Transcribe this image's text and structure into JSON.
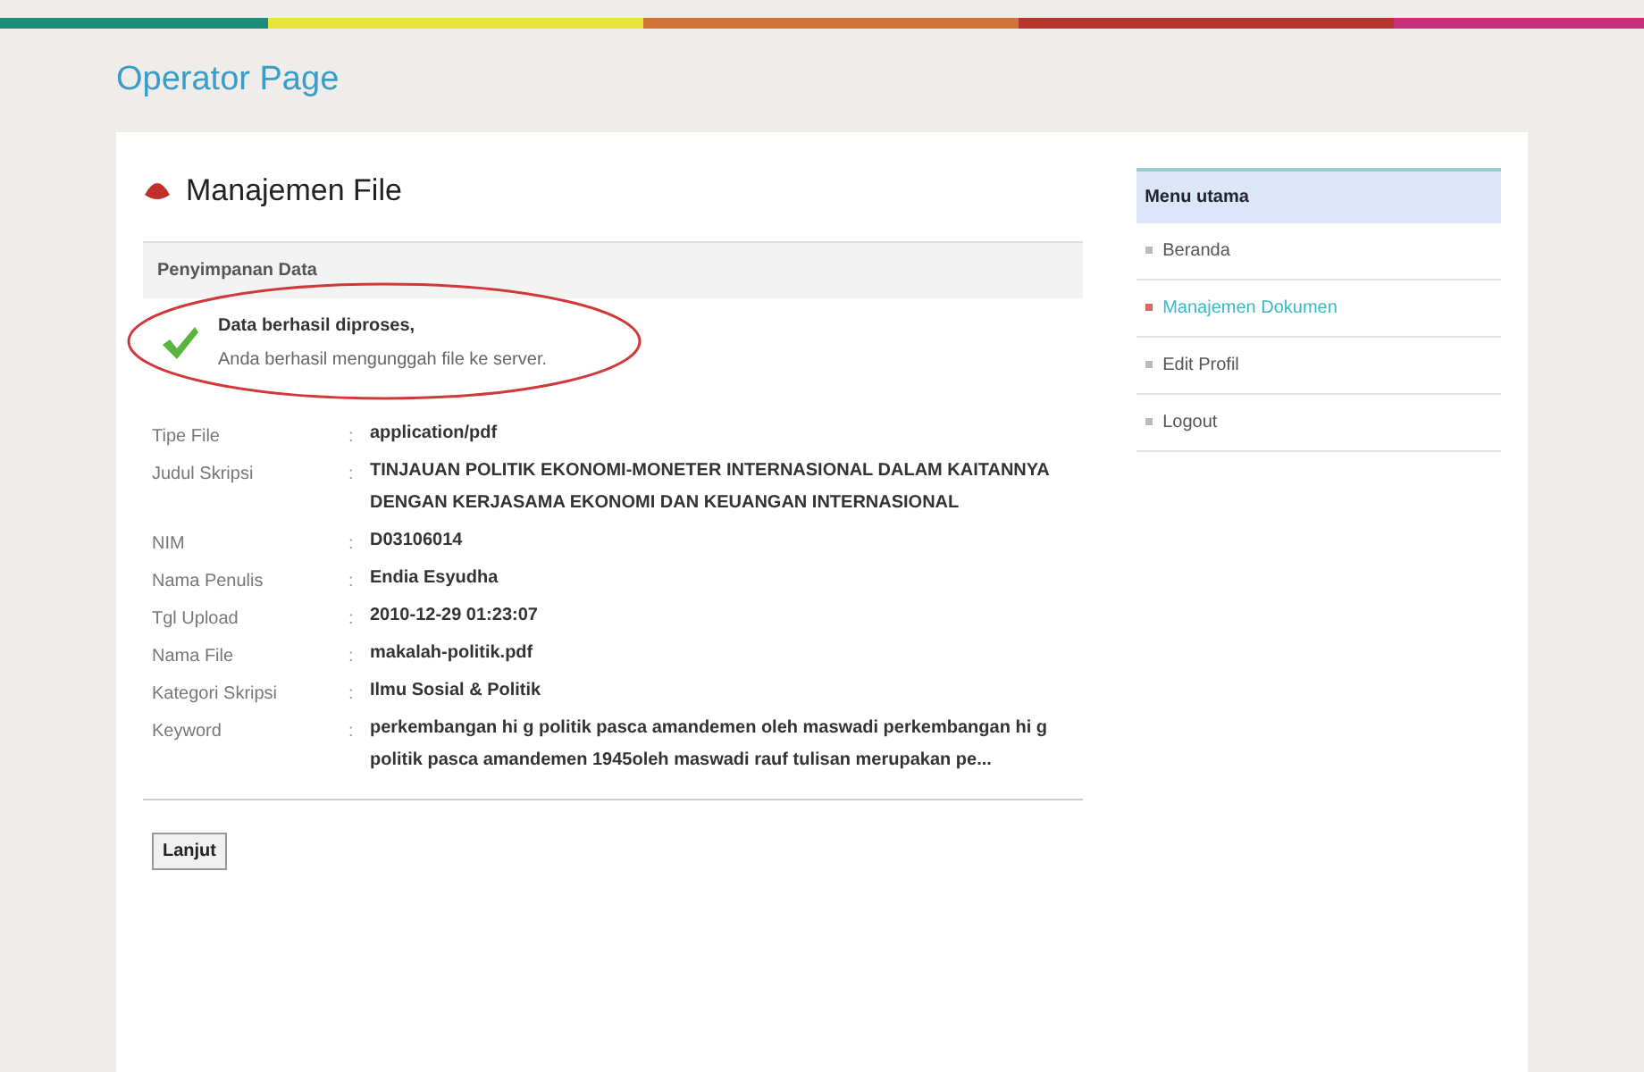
{
  "header": {
    "title": "Operator Page"
  },
  "page": {
    "title": "Manajemen File"
  },
  "section": {
    "title": "Penyimpanan Data"
  },
  "message": {
    "title": "Data berhasil diproses,",
    "text": "Anda berhasil mengunggah file ke server."
  },
  "details": [
    {
      "label": "Tipe File",
      "separator": ":",
      "value": "application/pdf"
    },
    {
      "label": "Judul Skripsi",
      "separator": ":",
      "value": "TINJAUAN POLITIK EKONOMI-MONETER INTERNASIONAL DALAM KAITANNYA DENGAN KERJASAMA EKONOMI DAN KEUANGAN INTERNASIONAL"
    },
    {
      "label": "NIM",
      "separator": ":",
      "value": "D03106014"
    },
    {
      "label": "Nama Penulis",
      "separator": ":",
      "value": "Endia Esyudha"
    },
    {
      "label": "Tgl Upload",
      "separator": ":",
      "value": "2010-12-29 01:23:07"
    },
    {
      "label": "Nama File",
      "separator": ":",
      "value": "makalah-politik.pdf"
    },
    {
      "label": "Kategori Skripsi",
      "separator": ":",
      "value": "Ilmu Sosial & Politik"
    },
    {
      "label": "Keyword",
      "separator": ":",
      "value": "perkembangan hi g politik pasca amandemen oleh maswadi perkembangan hi g politik pasca amandemen 1945oleh maswadi rauf tulisan merupakan pe..."
    }
  ],
  "button": "Lanjut",
  "sidebar": {
    "title": "Menu utama",
    "items": [
      {
        "label": "Beranda",
        "selected": false
      },
      {
        "label": "Manajemen Dokumen",
        "selected": true
      },
      {
        "label": "Edit Profil",
        "selected": false
      },
      {
        "label": "Logout",
        "selected": false
      }
    ]
  }
}
